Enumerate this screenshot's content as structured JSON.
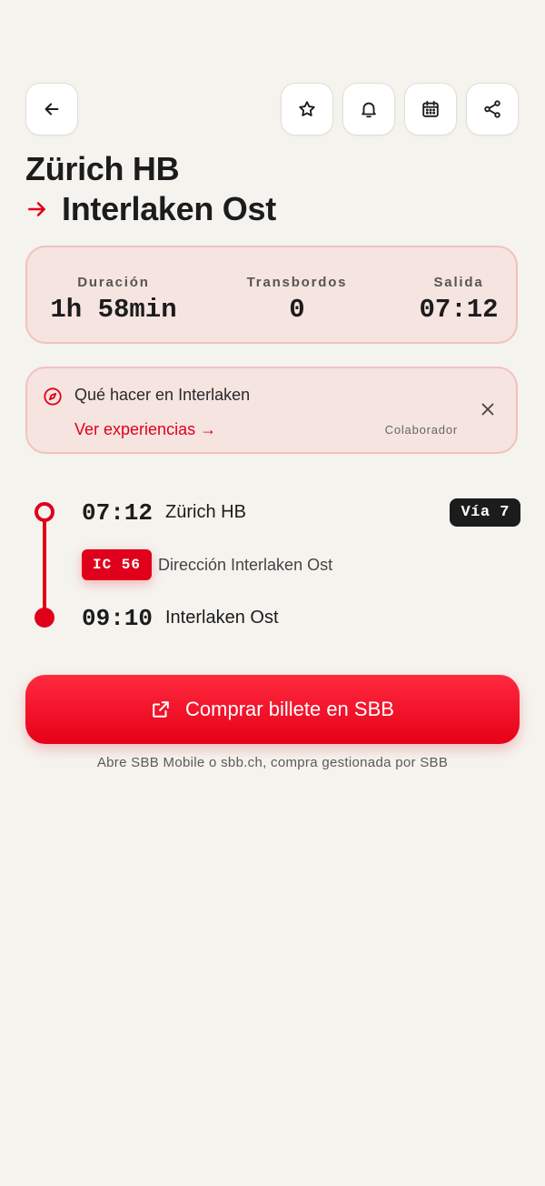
{
  "header": {
    "back_icon": "arrow-left-icon",
    "actions": [
      {
        "name": "favorite",
        "icon": "star-icon"
      },
      {
        "name": "alerts",
        "icon": "bell-icon"
      },
      {
        "name": "calendar",
        "icon": "calendar-icon"
      },
      {
        "name": "share",
        "icon": "share-icon"
      }
    ]
  },
  "route": {
    "origin": "Zürich HB",
    "destination": "Interlaken Ost",
    "arrow_icon": "arrow-right-icon"
  },
  "summary": {
    "duration_label": "Duración",
    "duration_value": "1h 58min",
    "transfers_label": "Transbordos",
    "transfers_value": "0",
    "departure_label": "Salida",
    "departure_value": "07:12"
  },
  "promo": {
    "icon": "compass-icon",
    "title": "Qué hacer en Interlaken",
    "link_label": "Ver experiencias →",
    "partner_label": "Colaborador",
    "close_icon": "close-icon"
  },
  "journey": {
    "departure": {
      "time": "07:12",
      "station": "Zürich HB",
      "platform": "Vía 7"
    },
    "train": {
      "code": "IC 56",
      "direction": "Dirección Interlaken Ost"
    },
    "arrival": {
      "time": "09:10",
      "station": "Interlaken Ost"
    }
  },
  "purchase": {
    "icon": "external-link-icon",
    "button_label": "Comprar billete en SBB",
    "note": "Abre SBB Mobile o sbb.ch, compra gestionada por SBB"
  },
  "colors": {
    "accent": "#e0001b",
    "background": "#f5f3ee",
    "card_tint": "#f5e4e0",
    "card_border": "#f0c2c0",
    "platform_badge": "#1c1c1c"
  }
}
